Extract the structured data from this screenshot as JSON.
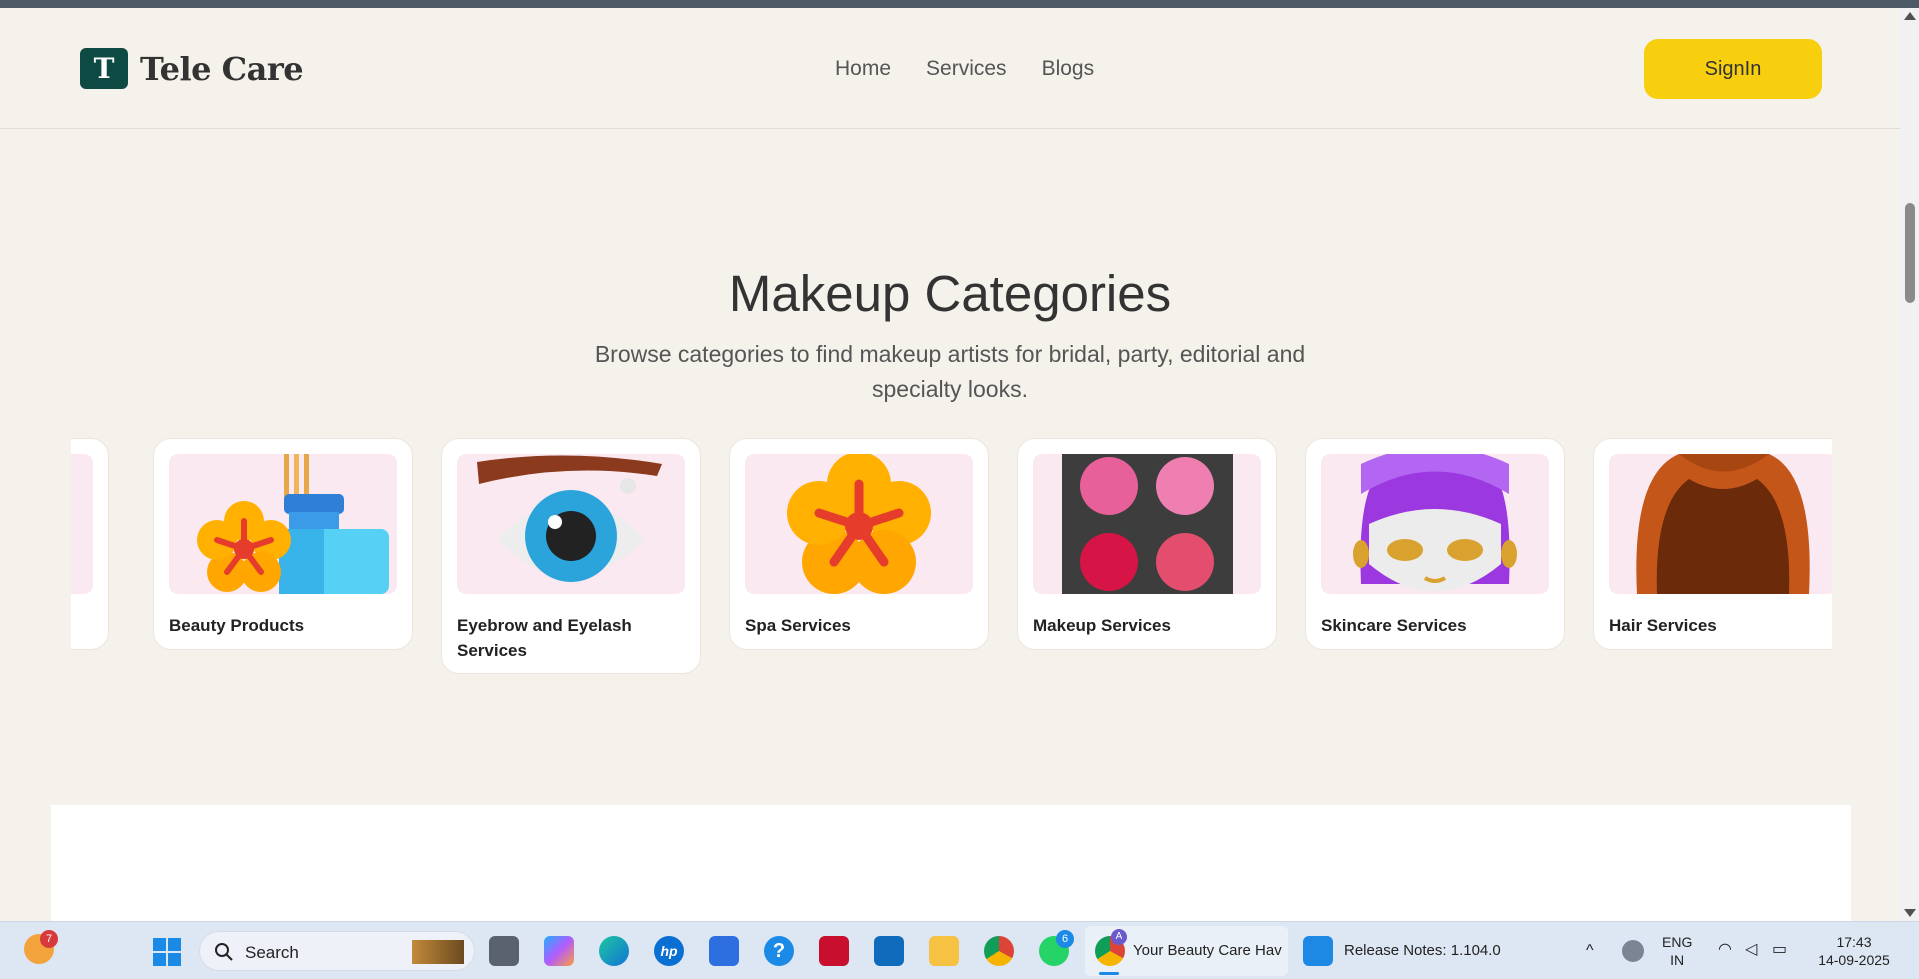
{
  "brand": {
    "logo_letter": "T",
    "name": "Tele Care"
  },
  "nav": [
    {
      "label": "Home"
    },
    {
      "label": "Services"
    },
    {
      "label": "Blogs"
    }
  ],
  "signin_label": "SignIn",
  "section": {
    "title": "Makeup Categories",
    "subtitle": "Browse categories to find makeup artists for bridal, party, editorial and specialty looks."
  },
  "categories": [
    {
      "label": ""
    },
    {
      "label": "Beauty Products",
      "icon": "flower-bottle-icon"
    },
    {
      "label": "Eyebrow and Eyelash Services",
      "icon": "eye-icon"
    },
    {
      "label": "Spa Services",
      "icon": "flower-icon"
    },
    {
      "label": "Makeup Services",
      "icon": "palette-icon"
    },
    {
      "label": "Skincare Services",
      "icon": "face-mask-icon"
    },
    {
      "label": "Hair Services",
      "icon": "hair-icon"
    }
  ],
  "taskbar": {
    "search_label": "Search",
    "notification_count": "7",
    "whatsapp_count": "6",
    "chrome_profile": "A",
    "active_app_title": "Your Beauty Care Hav",
    "vscode_title": "Release Notes: 1.104.0",
    "language": "ENG",
    "region": "IN",
    "time": "17:43",
    "date": "14-09-2025"
  },
  "colors": {
    "accent": "#f8cf0e",
    "brand": "#0e4a44",
    "background": "#f5f2eb",
    "card_image_bg": "#fbe9f1"
  }
}
